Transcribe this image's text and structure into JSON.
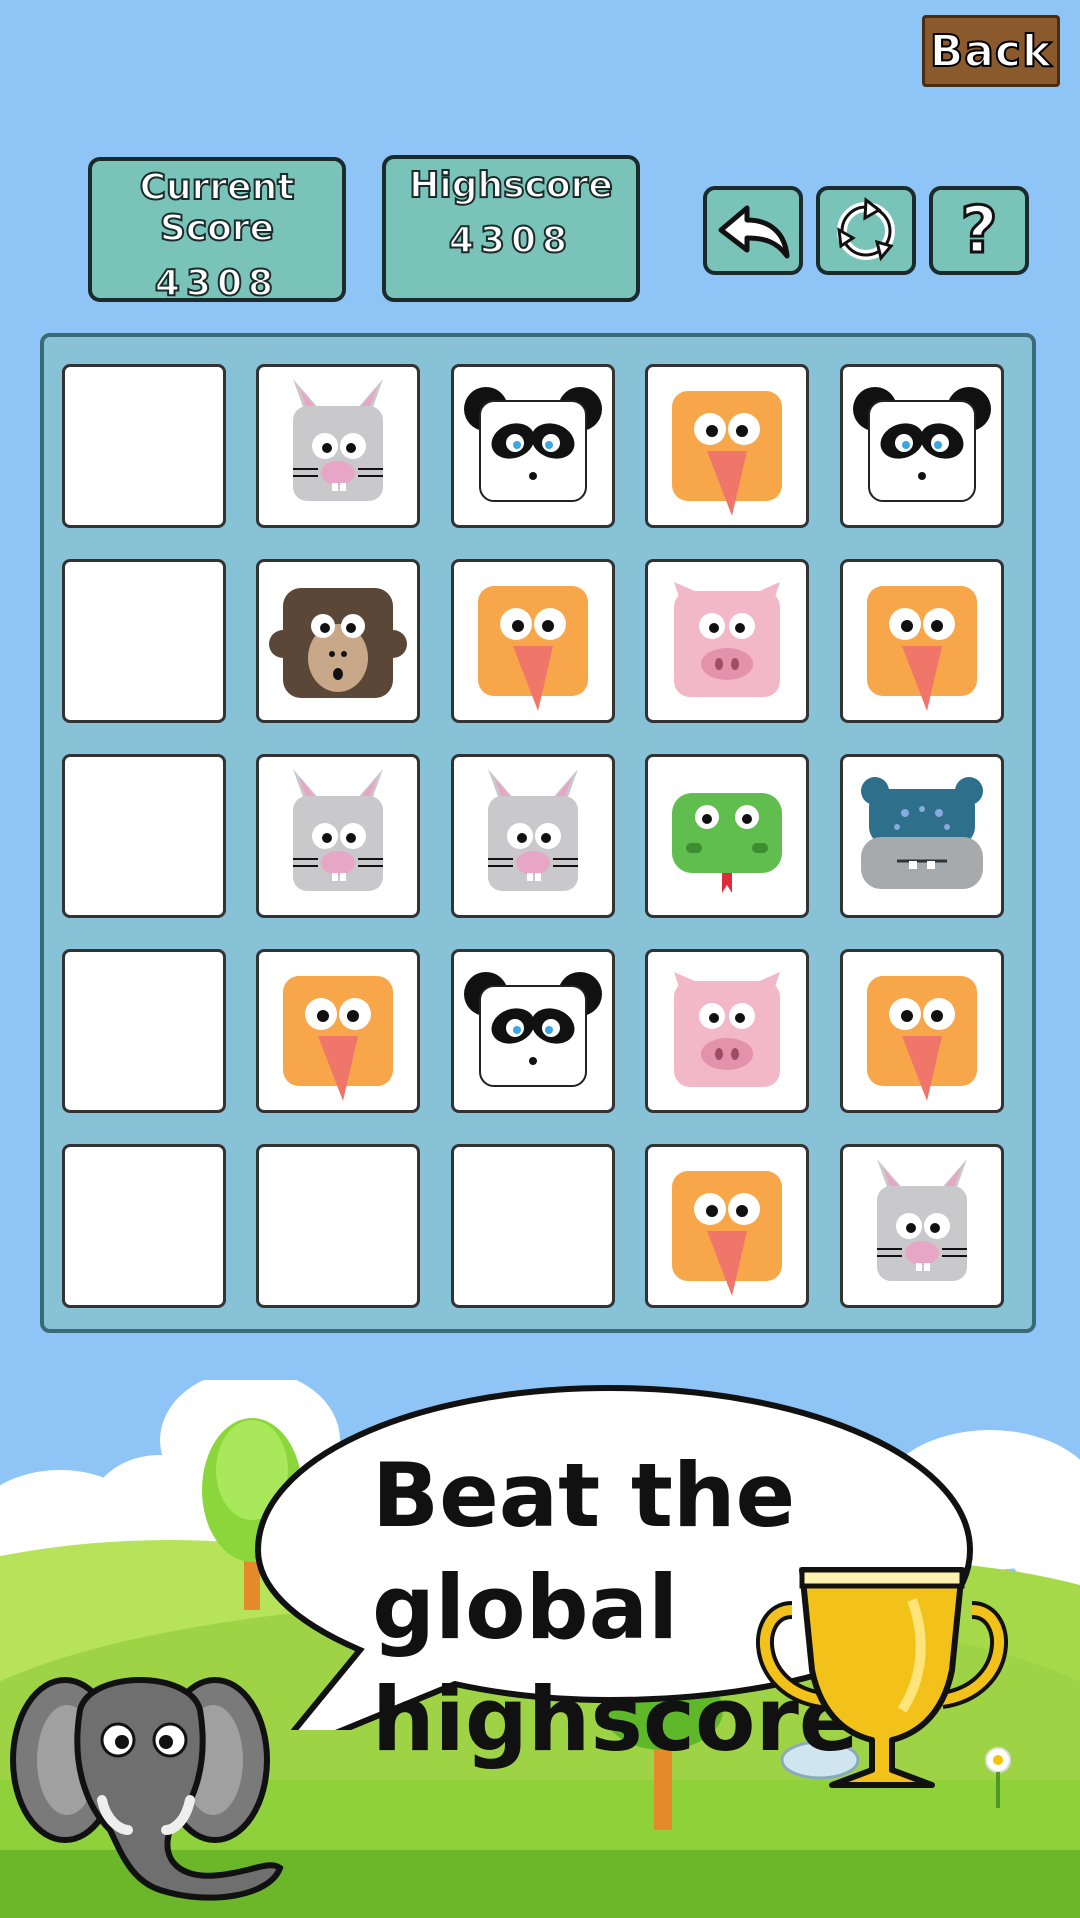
{
  "back_label": "Back",
  "score": {
    "current_label": "Current Score",
    "current_value": "4308",
    "high_label": "Highscore",
    "high_value": "4308"
  },
  "controls": [
    {
      "name": "undo-button",
      "icon": "undo-arrow-icon"
    },
    {
      "name": "restart-button",
      "icon": "recycle-icon"
    },
    {
      "name": "help-button",
      "icon": "question-icon"
    }
  ],
  "board": [
    [
      "empty",
      "rabbit",
      "panda",
      "bird",
      "panda"
    ],
    [
      "empty",
      "monkey",
      "bird",
      "pig",
      "bird"
    ],
    [
      "empty",
      "rabbit",
      "rabbit",
      "snake",
      "hippo"
    ],
    [
      "empty",
      "bird",
      "panda",
      "pig",
      "bird"
    ],
    [
      "empty",
      "empty",
      "empty",
      "bird",
      "rabbit"
    ]
  ],
  "promo": {
    "line1": "Beat the global",
    "line2": "highscore!"
  },
  "colors": {
    "sky": "#8fc4f7",
    "panel": "#7ac3b8",
    "board": "#88c2d6",
    "grass": "#8fd13a"
  }
}
